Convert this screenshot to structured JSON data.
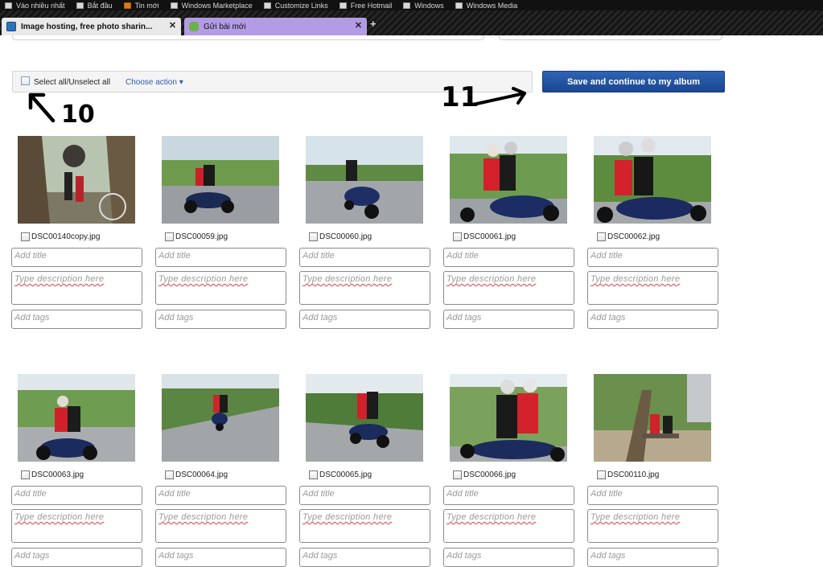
{
  "bookmarks": [
    {
      "label": "Vào nhiều nhất",
      "icon": "page-icon"
    },
    {
      "label": "Bắt đầu",
      "icon": "page-icon"
    },
    {
      "label": "Tin mới",
      "icon": "rss-icon"
    },
    {
      "label": "Windows Marketplace",
      "icon": "page-icon"
    },
    {
      "label": "Customize Links",
      "icon": "page-icon"
    },
    {
      "label": "Free Hotmail",
      "icon": "page-icon"
    },
    {
      "label": "Windows",
      "icon": "page-icon"
    },
    {
      "label": "Windows Media",
      "icon": "page-icon"
    }
  ],
  "tabs": [
    {
      "label": "Image hosting, free photo sharin...",
      "close": "✕"
    },
    {
      "label": "Gửi bài mới",
      "close": "✕"
    }
  ],
  "new_tab_label": "+",
  "toolbar": {
    "select_all_label": "Select all/Unselect all",
    "choose_action_label": "Choose action ▾",
    "save_label": "Save and continue to my album"
  },
  "annotations": {
    "left_number": "10",
    "right_number": "11"
  },
  "fields": {
    "title_placeholder": "Add title",
    "description_placeholder": "Type description here",
    "tags_placeholder": "Add tags"
  },
  "photos": [
    {
      "filename": "DSC00140copy.jpg"
    },
    {
      "filename": "DSC00059.jpg"
    },
    {
      "filename": "DSC00060.jpg"
    },
    {
      "filename": "DSC00061.jpg"
    },
    {
      "filename": "DSC00062.jpg"
    },
    {
      "filename": "DSC00063.jpg"
    },
    {
      "filename": "DSC00064.jpg"
    },
    {
      "filename": "DSC00065.jpg"
    },
    {
      "filename": "DSC00066.jpg"
    },
    {
      "filename": "DSC00110.jpg"
    }
  ],
  "colors": {
    "accent": "#1f4f9e",
    "tab_active": "#b39be6",
    "link": "#2a5db0"
  }
}
